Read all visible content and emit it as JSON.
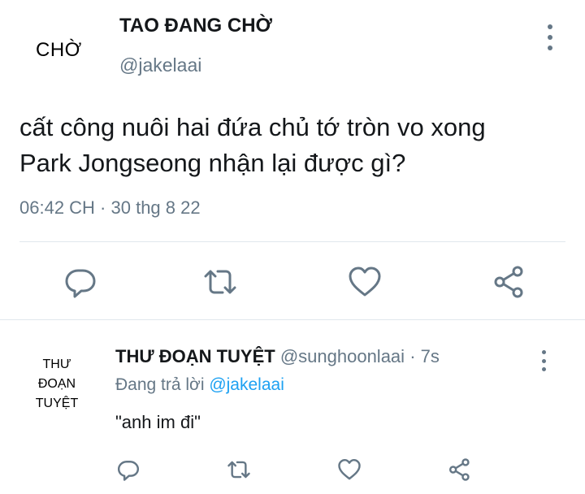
{
  "main_tweet": {
    "avatar_text": "CHỜ",
    "display_name": "TAO ĐANG CHỜ",
    "handle": "@jakelaai",
    "text_line1": "cất công nuôi hai đứa chủ tớ tròn vo xong",
    "text_line2": "Park Jongseong nhận lại được gì?",
    "timestamp": "06:42 CH · 30 thg 8 22",
    "actions": [
      "reply-icon",
      "retweet-icon",
      "like-icon",
      "share-icon"
    ]
  },
  "reply": {
    "avatar_line1": "THƯ",
    "avatar_line2": "ĐOẠN",
    "avatar_line3": "TUYỆT",
    "display_name": "THƯ ĐOẠN TUYỆT",
    "handle": "@sunghoonlaai",
    "separator": "·",
    "time": "7s",
    "replying_prefix": "Đang trả lời",
    "replying_to": "@jakelaai",
    "text": "\"anh im đi\"",
    "actions": [
      "reply-icon",
      "retweet-icon",
      "like-icon",
      "share-icon"
    ]
  },
  "colors": {
    "text": "#14171a",
    "secondary": "#657786",
    "accent": "#1da1f2",
    "divider": "#e1e8ed"
  }
}
